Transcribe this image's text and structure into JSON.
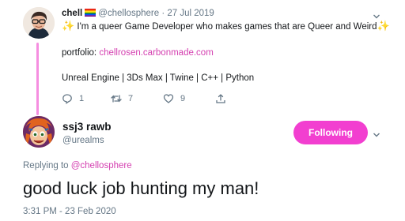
{
  "parent_tweet": {
    "name": "chell",
    "handle": "@chellosphere",
    "separator": "·",
    "date": "27 Jul 2019",
    "line1_sparkle_left": "✨",
    "line1_text": " I'm a queer Game Developer who makes games that are Queer and Weird",
    "line1_sparkle_right": "✨",
    "portfolio_label": "portfolio: ",
    "portfolio_link": "chellrosen.carbonmade.com",
    "tech_line": "Unreal Engine | 3Ds Max | Twine | C++ | Python",
    "reply_count": "1",
    "retweet_count": "7",
    "like_count": "9"
  },
  "reply_tweet": {
    "name": "ssj3 rawb",
    "handle": "@urealms",
    "follow_label": "Following",
    "replying_prefix": "Replying to ",
    "replying_mention": "@chellosphere",
    "text": "good luck job hunting my man!",
    "timestamp": "3:31 PM - 23 Feb 2020"
  },
  "colors": {
    "accent": "#d43fb0",
    "follow_button": "#f23fd0",
    "thread_line": "#f58ee0",
    "muted_text": "#657786"
  },
  "icons": {
    "reply": "reply-icon",
    "retweet": "retweet-icon",
    "like": "heart-icon",
    "share": "share-icon",
    "caret": "chevron-down-icon",
    "pride_flag": "rainbow-flag-icon"
  }
}
